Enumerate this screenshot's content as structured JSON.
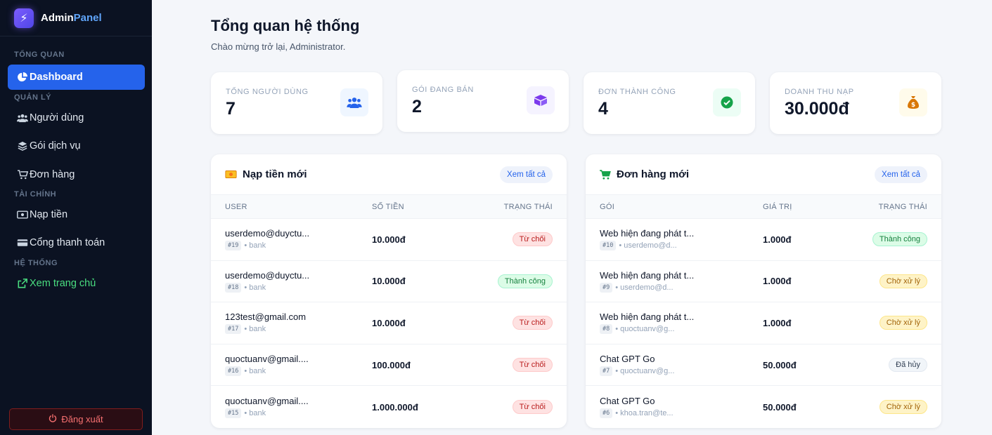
{
  "brand": {
    "name_main": "Admin",
    "name_accent": "Panel",
    "logo_icon": "bolt-icon"
  },
  "sidebar": {
    "sections": [
      "TỔNG QUAN",
      "QUẢN LÝ",
      "TÀI CHÍNH",
      "HỆ THỐNG"
    ],
    "items": [
      {
        "label": "Dashboard",
        "icon": "pie-chart-icon"
      },
      {
        "label": "Người dùng",
        "icon": "users-icon"
      },
      {
        "label": "Gói dịch vụ",
        "icon": "layers-icon"
      },
      {
        "label": "Đơn hàng",
        "icon": "cart-icon"
      },
      {
        "label": "Nạp tiền",
        "icon": "cash-icon"
      },
      {
        "label": "Cổng thanh toán",
        "icon": "credit-card-icon"
      },
      {
        "label": "Xem trang chủ",
        "icon": "external-link-icon"
      }
    ],
    "logout": "Đăng xuất"
  },
  "header": {
    "title": "Tổng quan hệ thống",
    "subtitle": "Chào mừng trở lại, Administrator."
  },
  "stats": [
    {
      "label": "TỔNG NGƯỜI DÙNG",
      "value": "7",
      "icon": "users-icon",
      "color": "#2563eb"
    },
    {
      "label": "GÓI ĐANG BÁN",
      "value": "2",
      "icon": "box-icon",
      "color": "#7c3aed"
    },
    {
      "label": "ĐƠN THÀNH CÔNG",
      "value": "4",
      "icon": "check-circle-icon",
      "color": "#16a34a"
    },
    {
      "label": "DOANH THU NẠP",
      "value": "30.000đ",
      "icon": "money-bag-icon",
      "color": "#d97706"
    }
  ],
  "deposits": {
    "title": "Nạp tiền mới",
    "view_all": "Xem tất cả",
    "columns": [
      "USER",
      "SỐ TIỀN",
      "TRẠNG THÁI"
    ],
    "rows": [
      {
        "user": "userdemo@duyctu...",
        "id": "#19",
        "method": "bank",
        "amount": "10.000đ",
        "status": "Từ chối"
      },
      {
        "user": "userdemo@duyctu...",
        "id": "#18",
        "method": "bank",
        "amount": "10.000đ",
        "status": "Thành công"
      },
      {
        "user": "123test@gmail.com",
        "id": "#17",
        "method": "bank",
        "amount": "10.000đ",
        "status": "Từ chối"
      },
      {
        "user": "quoctuanv@gmail....",
        "id": "#16",
        "method": "bank",
        "amount": "100.000đ",
        "status": "Từ chối"
      },
      {
        "user": "quoctuanv@gmail....",
        "id": "#15",
        "method": "bank",
        "amount": "1.000.000đ",
        "status": "Từ chối"
      }
    ]
  },
  "orders": {
    "title": "Đơn hàng mới",
    "view_all": "Xem tất cả",
    "columns": [
      "GÓI",
      "GIÁ TRỊ",
      "TRẠNG THÁI"
    ],
    "rows": [
      {
        "package": "Web hiện đang phát t...",
        "id": "#10",
        "user": "userdemo@d...",
        "value": "1.000đ",
        "status": "Thành công"
      },
      {
        "package": "Web hiện đang phát t...",
        "id": "#9",
        "user": "userdemo@d...",
        "value": "1.000đ",
        "status": "Chờ xử lý"
      },
      {
        "package": "Web hiện đang phát t...",
        "id": "#8",
        "user": "quoctuanv@g...",
        "value": "1.000đ",
        "status": "Chờ xử lý"
      },
      {
        "package": "Chat GPT Go",
        "id": "#7",
        "user": "quoctuanv@g...",
        "value": "50.000đ",
        "status": "Đã hủy"
      },
      {
        "package": "Chat GPT Go",
        "id": "#6",
        "user": "khoa.tran@te...",
        "value": "50.000đ",
        "status": "Chờ xử lý"
      }
    ]
  },
  "status_colors": {
    "Từ chối": "b-reject",
    "Thành công": "b-ok",
    "Chờ xử lý": "b-pending",
    "Đã hủy": "b-cancel"
  },
  "colors": {
    "sidebar_bg": "#0b1222",
    "accent": "#2563eb",
    "link_green": "#4ade80"
  }
}
